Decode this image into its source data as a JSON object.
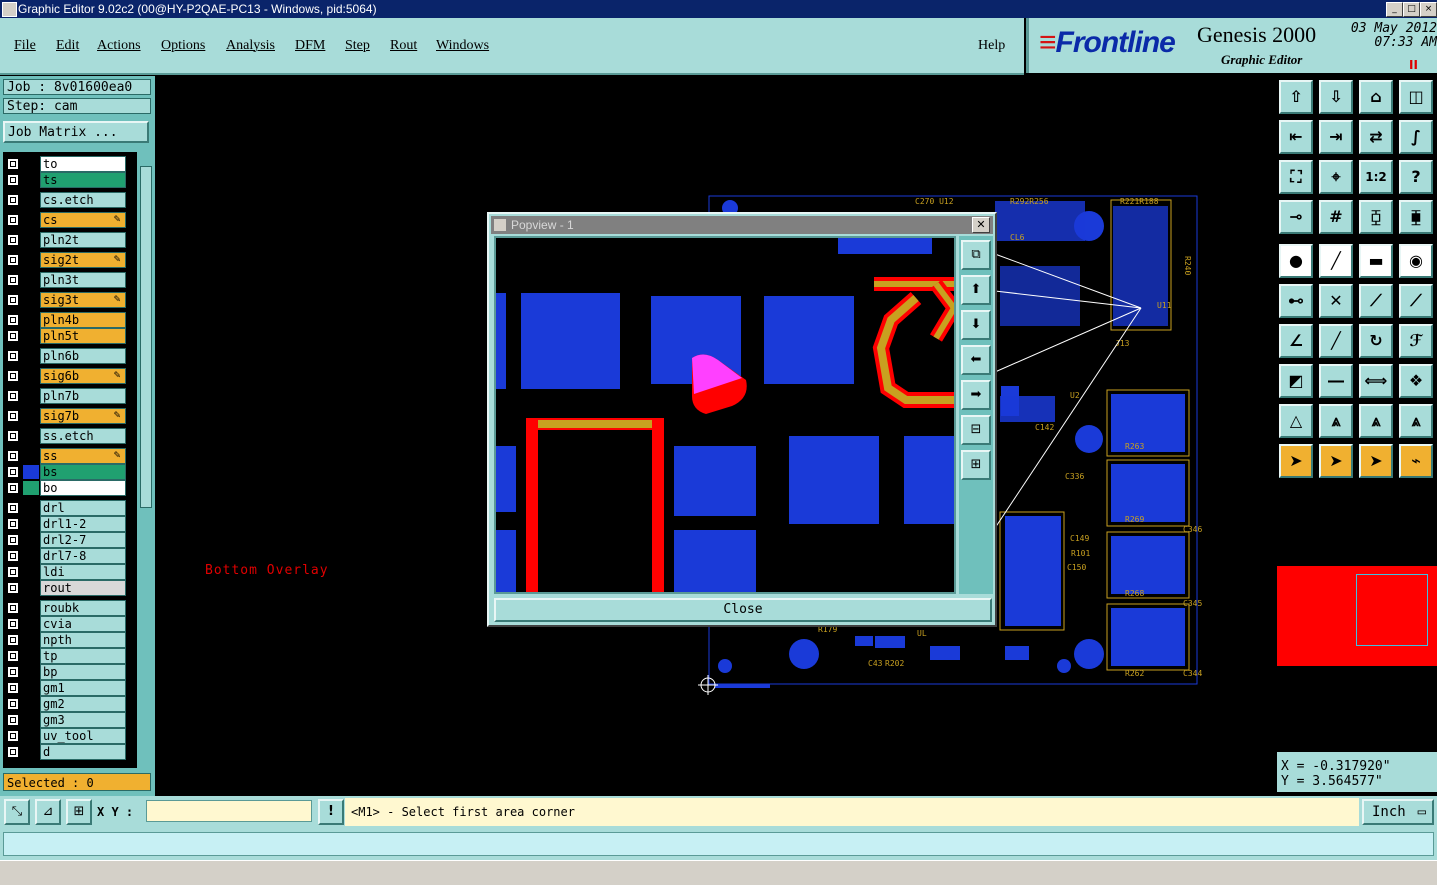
{
  "window": {
    "title": "Graphic Editor 9.02c2 (00@HY-P2QAE-PC13 - Windows, pid:5064)"
  },
  "menu": {
    "items": [
      "File",
      "Edit",
      "Actions",
      "Options",
      "Analysis",
      "DFM",
      "Step",
      "Rout",
      "Windows"
    ],
    "help": "Help"
  },
  "brand": {
    "logo": "Frontline",
    "product": "Genesis 2000",
    "subtitle": "Graphic Editor",
    "date": "03 May 2012",
    "time": "07:33 AM",
    "indicator": "II"
  },
  "job": {
    "job_label": "Job : 8v01600ea0",
    "step_label": "Step: cam",
    "matrix_button": "Job Matrix ..."
  },
  "layers": [
    {
      "name": "to",
      "color": "#ffffff",
      "swatch": "#000000"
    },
    {
      "name": "ts",
      "color": "#20a070",
      "swatch": "#000000"
    },
    {
      "name": "cs.etch",
      "color": "#a8dcd9",
      "swatch": "#000000"
    },
    {
      "name": "cs",
      "color": "#f0b030",
      "swatch": "#000000",
      "editable": true
    },
    {
      "name": "pln2t",
      "color": "#a8dcd9",
      "swatch": "#000000"
    },
    {
      "name": "sig2t",
      "color": "#f0b030",
      "swatch": "#000000",
      "editable": true
    },
    {
      "name": "pln3t",
      "color": "#a8dcd9",
      "swatch": "#000000"
    },
    {
      "name": "sig3t",
      "color": "#f0b030",
      "swatch": "#000000",
      "editable": true
    },
    {
      "name": "pln4b",
      "color": "#f0b030",
      "swatch": "#000000"
    },
    {
      "name": "pln5t",
      "color": "#f0b030",
      "swatch": "#000000"
    },
    {
      "name": "pln6b",
      "color": "#a8dcd9",
      "swatch": "#000000"
    },
    {
      "name": "sig6b",
      "color": "#f0b030",
      "swatch": "#000000",
      "editable": true
    },
    {
      "name": "pln7b",
      "color": "#a8dcd9",
      "swatch": "#000000"
    },
    {
      "name": "sig7b",
      "color": "#f0b030",
      "swatch": "#000000",
      "editable": true
    },
    {
      "name": "ss.etch",
      "color": "#a8dcd9",
      "swatch": "#000000"
    },
    {
      "name": "ss",
      "color": "#f0b030",
      "swatch": "#000000",
      "editable": true
    },
    {
      "name": "bs",
      "color": "#20a070",
      "swatch": "#1a3ad8"
    },
    {
      "name": "bo",
      "color": "#ffffff",
      "swatch": "#20a070",
      "active": true
    },
    {
      "name": "drl",
      "color": "#a8dcd9",
      "swatch": "#000000"
    },
    {
      "name": "drl1-2",
      "color": "#a8dcd9",
      "swatch": "#000000"
    },
    {
      "name": "drl2-7",
      "color": "#a8dcd9",
      "swatch": "#000000"
    },
    {
      "name": "drl7-8",
      "color": "#a8dcd9",
      "swatch": "#000000"
    },
    {
      "name": "ldi",
      "color": "#a8dcd9",
      "swatch": "#000000"
    },
    {
      "name": "rout",
      "color": "#d8d8d8",
      "swatch": "#000000"
    },
    {
      "name": "roubk",
      "color": "#a8dcd9",
      "swatch": "#000000"
    },
    {
      "name": "cvia",
      "color": "#a8dcd9",
      "swatch": "#000000"
    },
    {
      "name": "npth",
      "color": "#a8dcd9",
      "swatch": "#000000"
    },
    {
      "name": "tp",
      "color": "#a8dcd9",
      "swatch": "#000000"
    },
    {
      "name": "bp",
      "color": "#a8dcd9",
      "swatch": "#000000"
    },
    {
      "name": "gm1",
      "color": "#a8dcd9",
      "swatch": "#000000"
    },
    {
      "name": "gm2",
      "color": "#a8dcd9",
      "swatch": "#000000"
    },
    {
      "name": "gm3",
      "color": "#a8dcd9",
      "swatch": "#000000"
    },
    {
      "name": "uv_tool",
      "color": "#a8dcd9",
      "swatch": "#000000"
    },
    {
      "name": "d",
      "color": "#a8dcd9",
      "swatch": "#000000"
    }
  ],
  "selected": "Selected : 0",
  "canvas": {
    "overlay_label": "Bottom Overlay"
  },
  "popview": {
    "title": "Popview - 1",
    "close_label": "Close"
  },
  "coords": {
    "x": "X = -0.317920\"",
    "y": "Y = 3.564577\""
  },
  "bottom": {
    "xy_label": "X Y :",
    "prompt": "<M1> - Select first area corner",
    "units": "Inch"
  },
  "colors": {
    "teal": "#a8dcd9",
    "layer_active": "#f0b030",
    "pad_blue": "#1a3ad8",
    "mask_red": "#ff0000",
    "silk_gold": "#c8a020"
  }
}
